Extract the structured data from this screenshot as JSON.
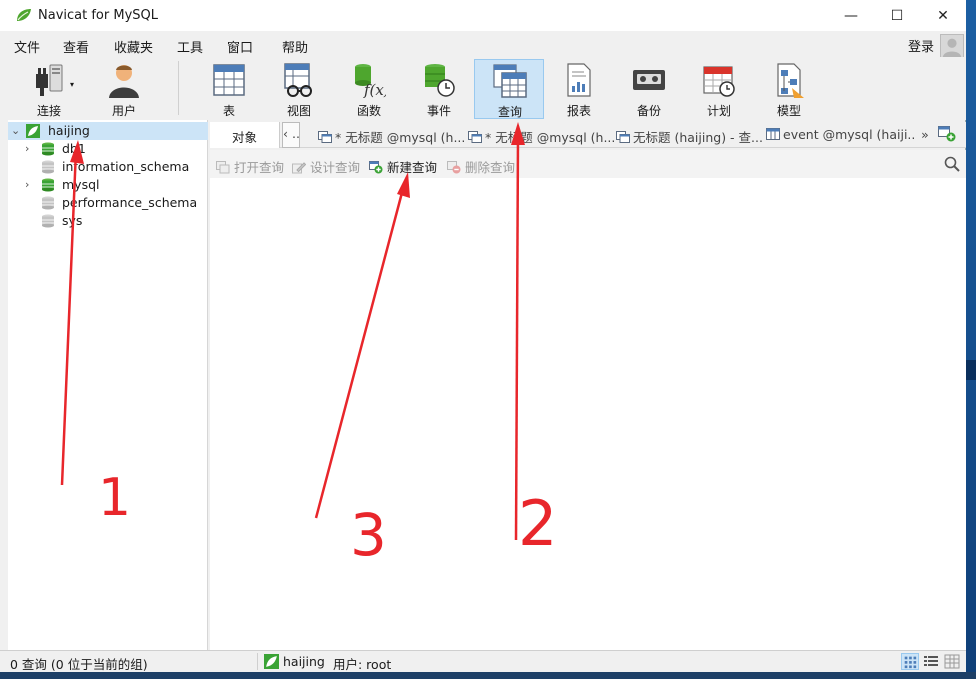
{
  "app": {
    "title": "Navicat for MySQL"
  },
  "window_controls": {
    "minimize": "—",
    "maximize": "☐",
    "close": "✕"
  },
  "menu": [
    "文件",
    "查看",
    "收藏夹",
    "工具",
    "窗口",
    "帮助"
  ],
  "login_label": "登录",
  "toolbar": [
    {
      "label": "连接",
      "icon": "connection-plug-icon"
    },
    {
      "label": "用户",
      "icon": "user-icon"
    },
    {
      "label": "表",
      "icon": "table-icon"
    },
    {
      "label": "视图",
      "icon": "view-icon"
    },
    {
      "label": "函数",
      "icon": "function-icon"
    },
    {
      "label": "事件",
      "icon": "event-icon"
    },
    {
      "label": "查询",
      "icon": "query-icon",
      "active": true
    },
    {
      "label": "报表",
      "icon": "report-icon"
    },
    {
      "label": "备份",
      "icon": "backup-icon"
    },
    {
      "label": "计划",
      "icon": "schedule-icon"
    },
    {
      "label": "模型",
      "icon": "model-icon"
    }
  ],
  "tree": {
    "connection": "haijing",
    "databases": [
      {
        "name": "db1",
        "open": true,
        "expandable": true
      },
      {
        "name": "information_schema",
        "open": false,
        "expandable": false
      },
      {
        "name": "mysql",
        "open": true,
        "expandable": true
      },
      {
        "name": "performance_schema",
        "open": false,
        "expandable": false
      },
      {
        "name": "sys",
        "open": false,
        "expandable": false
      }
    ]
  },
  "tabs": {
    "objects": "对象",
    "prev_tab": "‹ ..",
    "items": [
      "* 无标题 @mysql (h...",
      "* 无标题 @mysql (h...",
      "无标题 (haijing) - 查...",
      "event @mysql (haiji..."
    ],
    "overflow": "»"
  },
  "object_toolbar": {
    "open": "打开查询",
    "design": "设计查询",
    "new": "新建查询",
    "delete": "删除查询"
  },
  "status": {
    "left": "0 查询 (0 位于当前的组)",
    "connection": "haijing",
    "user": "用户: root"
  },
  "annotations": [
    "1",
    "2",
    "3"
  ],
  "colors": {
    "accent": "#cce4f7",
    "db_green": "#3aa335",
    "arrow_red": "#e8262b"
  }
}
